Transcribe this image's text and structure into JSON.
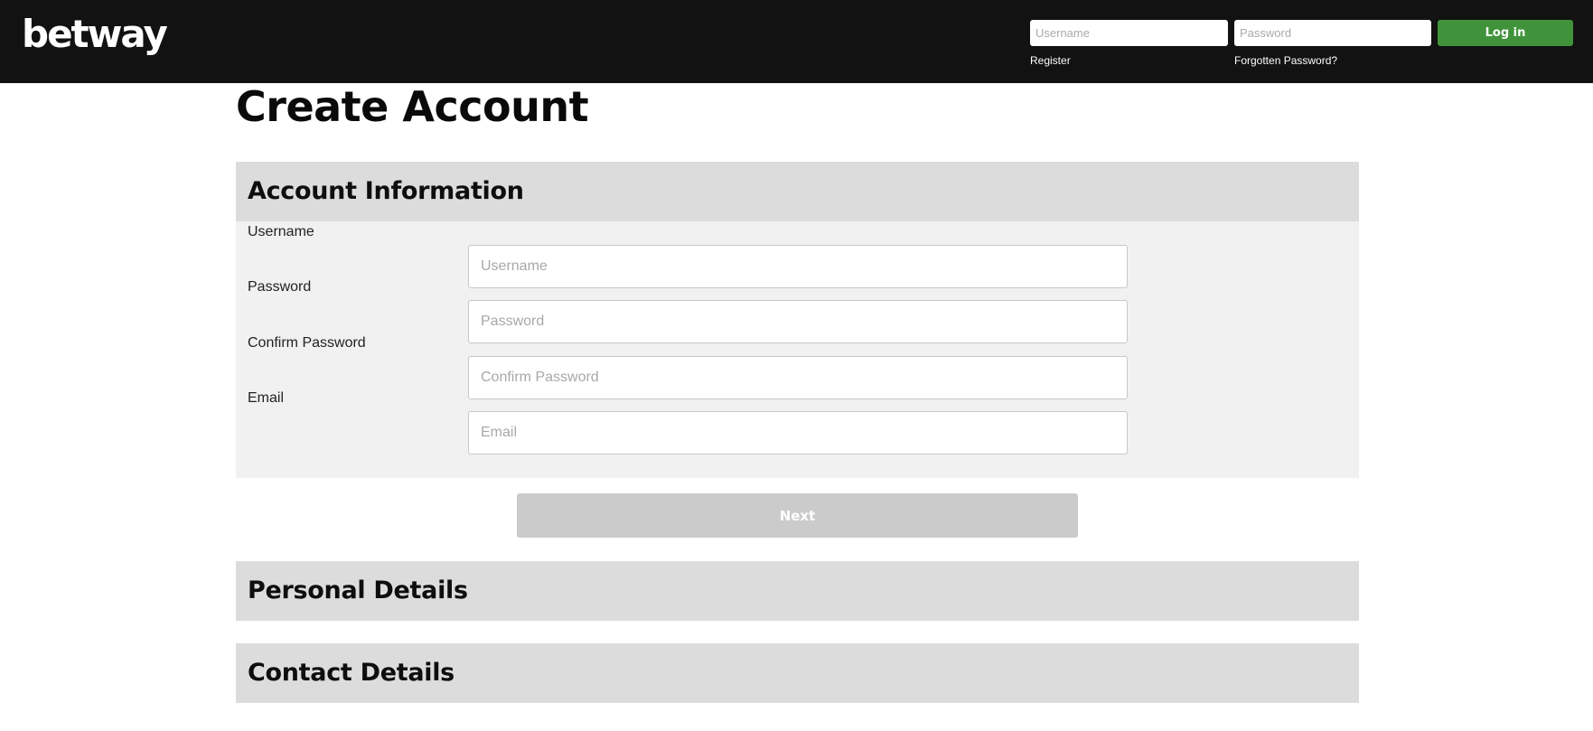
{
  "header": {
    "logo_text": "betway",
    "username_placeholder": "Username",
    "password_placeholder": "Password",
    "login_label": "Log in",
    "register_label": "Register",
    "forgot_password_label": "Forgotten Password?",
    "colors": {
      "background": "#121212",
      "login_button": "#40933b"
    }
  },
  "page": {
    "title": "Create Account"
  },
  "sections": {
    "account_information": {
      "title": "Account Information",
      "fields": [
        {
          "label": "Username",
          "placeholder": "Username",
          "value": ""
        },
        {
          "label": "Password",
          "placeholder": "Password",
          "value": ""
        },
        {
          "label": "Confirm Password",
          "placeholder": "Confirm Password",
          "value": ""
        },
        {
          "label": "Email",
          "placeholder": "Email",
          "value": ""
        }
      ],
      "next_label": "Next"
    },
    "personal_details": {
      "title": "Personal Details"
    },
    "contact_details": {
      "title": "Contact Details"
    }
  }
}
